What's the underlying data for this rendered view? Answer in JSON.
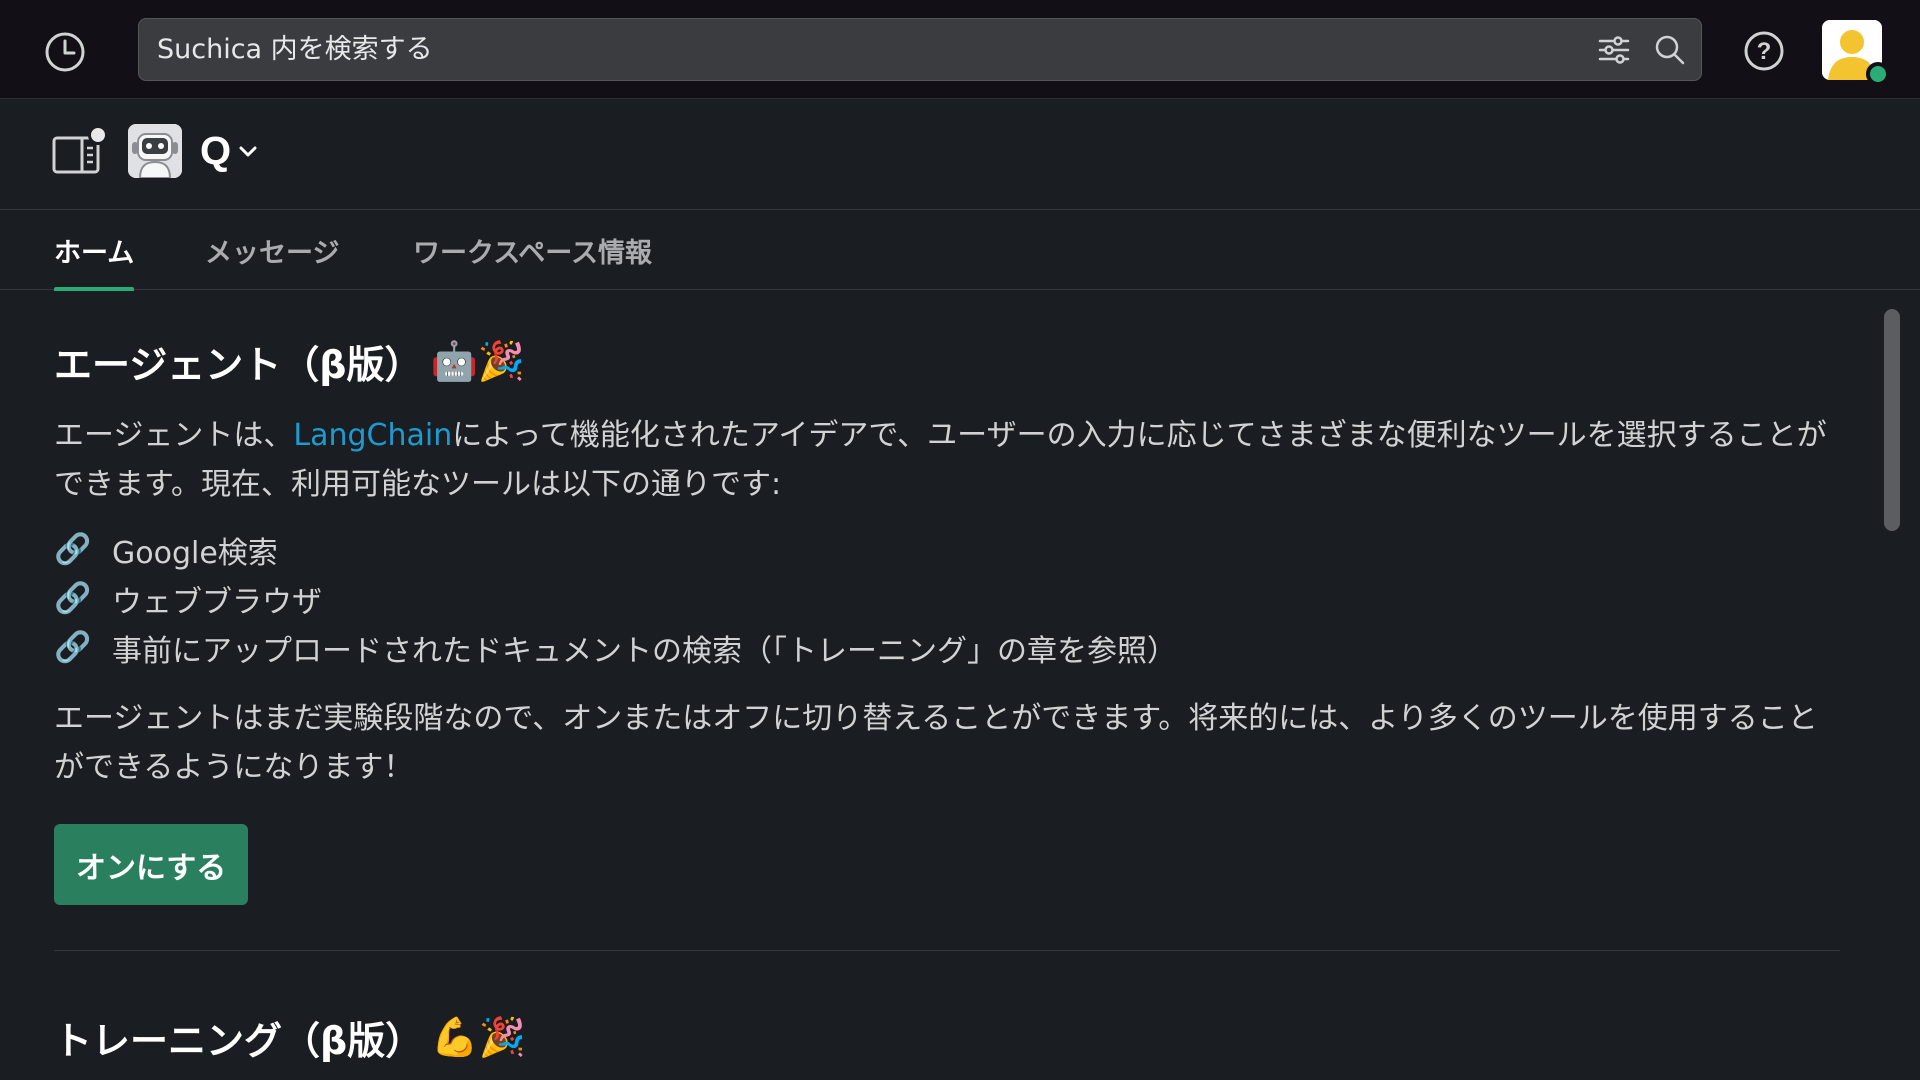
{
  "topbar": {
    "search_placeholder": "Suchica 内を検索する",
    "icons": {
      "history": "clock-history-icon",
      "filter": "sliders-filter-icon",
      "search": "magnifier-search-icon",
      "help": "question-circle-icon"
    },
    "presence_color": "#2bac76"
  },
  "channel": {
    "app_name": "Q",
    "icons": {
      "panel_toggle": "side-panel-icon",
      "dropdown": "chevron-down-icon"
    }
  },
  "tabs": [
    {
      "label": "ホーム",
      "active": true
    },
    {
      "label": "メッセージ",
      "active": false
    },
    {
      "label": "ワークスペース情報",
      "active": false
    }
  ],
  "agent_section": {
    "title": "エージェント（β版）",
    "title_emojis": "🤖🎉",
    "intro_before_link": "エージェントは、",
    "intro_link": "LangChain",
    "intro_after_link": "によって機能化されたアイデアで、ユーザーの入力に応じてさまざまな便利なツールを選択することができます。現在、利用可能なツールは以下の通りです:",
    "tool_emoji": "🔗",
    "tools": [
      "Google検索",
      "ウェブブラウザ",
      "事前にアップロードされたドキュメントの検索（「トレーニング」の章を参照）"
    ],
    "note": "エージェントはまだ実験段階なので、オンまたはオフに切り替えることができます。将来的には、より多くのツールを使用することができるようになります！",
    "button_label": "オンにする"
  },
  "training_section": {
    "title": "トレーニング（β版）",
    "title_emojis": "💪🎉"
  },
  "colors": {
    "accent_green": "#2bac76",
    "button_green": "#2a7f5e",
    "link_blue": "#1d9bd1",
    "background": "#1a1d21"
  }
}
